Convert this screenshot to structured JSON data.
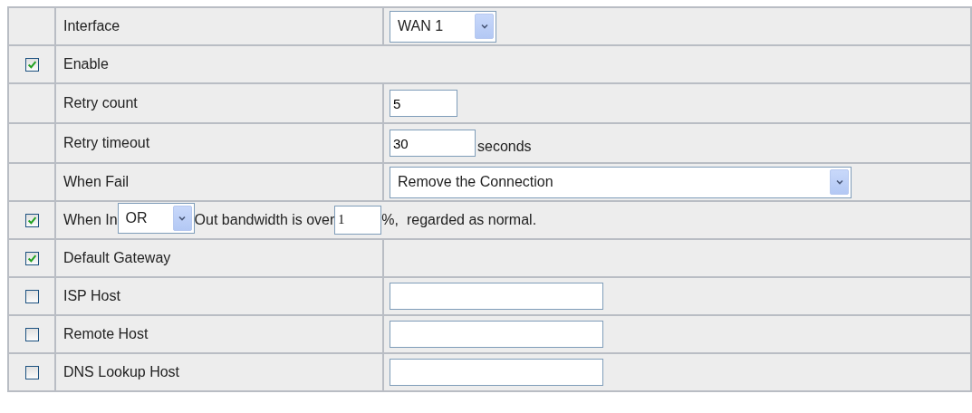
{
  "rows": [
    {
      "kind": "short-select",
      "label": "Interface",
      "value": "WAN 1"
    },
    {
      "kind": "span",
      "label": "Enable",
      "checked": true
    },
    {
      "kind": "short-input",
      "label": "Retry count",
      "value": "5"
    },
    {
      "kind": "medium-input",
      "label": "Retry timeout",
      "value": "30",
      "suffix": "seconds"
    },
    {
      "kind": "wide-select",
      "label": "When Fail",
      "value": "Remove the Connection"
    },
    {
      "kind": "bandwidth",
      "checked": true,
      "prefix": "When In",
      "option": "OR",
      "middle": "Out bandwidth is over",
      "value": "1",
      "suffix": "%,  regarded as normal."
    },
    {
      "kind": "empty",
      "label": "Default Gateway",
      "checked": true
    },
    {
      "kind": "long-input",
      "label": "ISP Host",
      "checked": false,
      "value": ""
    },
    {
      "kind": "long-input",
      "label": "Remote Host",
      "checked": false,
      "value": ""
    },
    {
      "kind": "long-input",
      "label": "DNS Lookup Host",
      "checked": false,
      "value": ""
    }
  ]
}
